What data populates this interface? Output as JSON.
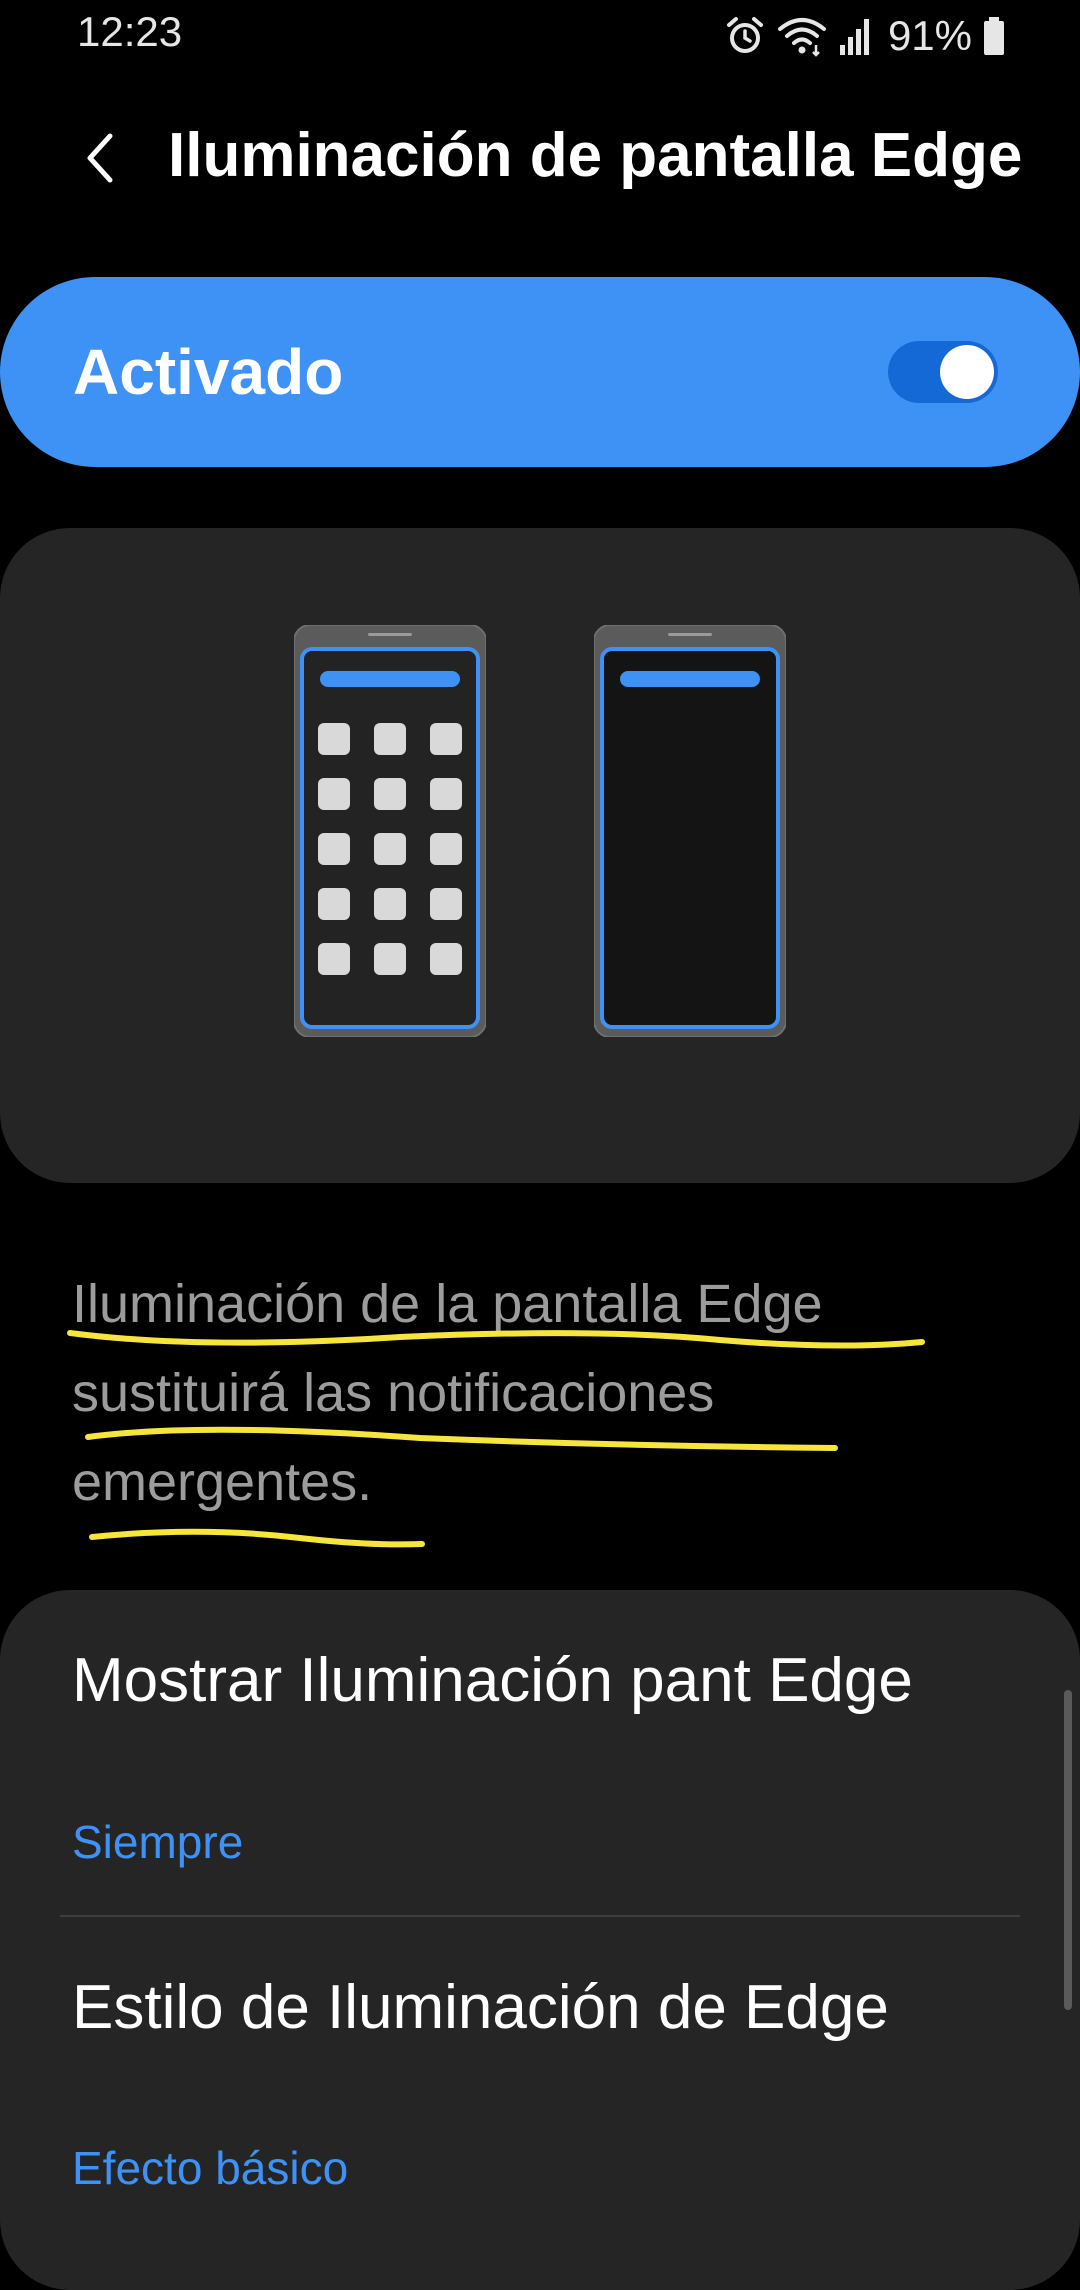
{
  "status_bar": {
    "time": "12:23",
    "battery": "91%",
    "icons": [
      "alarm-icon",
      "wifi-icon",
      "signal-icon",
      "battery-icon"
    ]
  },
  "header": {
    "back_icon": "chevron-left-icon",
    "title": "Iluminación de pantalla Edge"
  },
  "master_switch": {
    "label": "Activado",
    "state": "on",
    "accent_color": "#3e91f5"
  },
  "preview": {
    "phones": [
      "phone-with-apps-icon",
      "phone-blank-icon"
    ]
  },
  "description": "Iluminación de la pantalla Edge sustituirá las notificaciones emergentes.",
  "settings": [
    {
      "title": "Mostrar Iluminación pant Edge",
      "value": "Siempre"
    },
    {
      "title": "Estilo de Iluminación de Edge",
      "value": "Efecto básico"
    }
  ]
}
